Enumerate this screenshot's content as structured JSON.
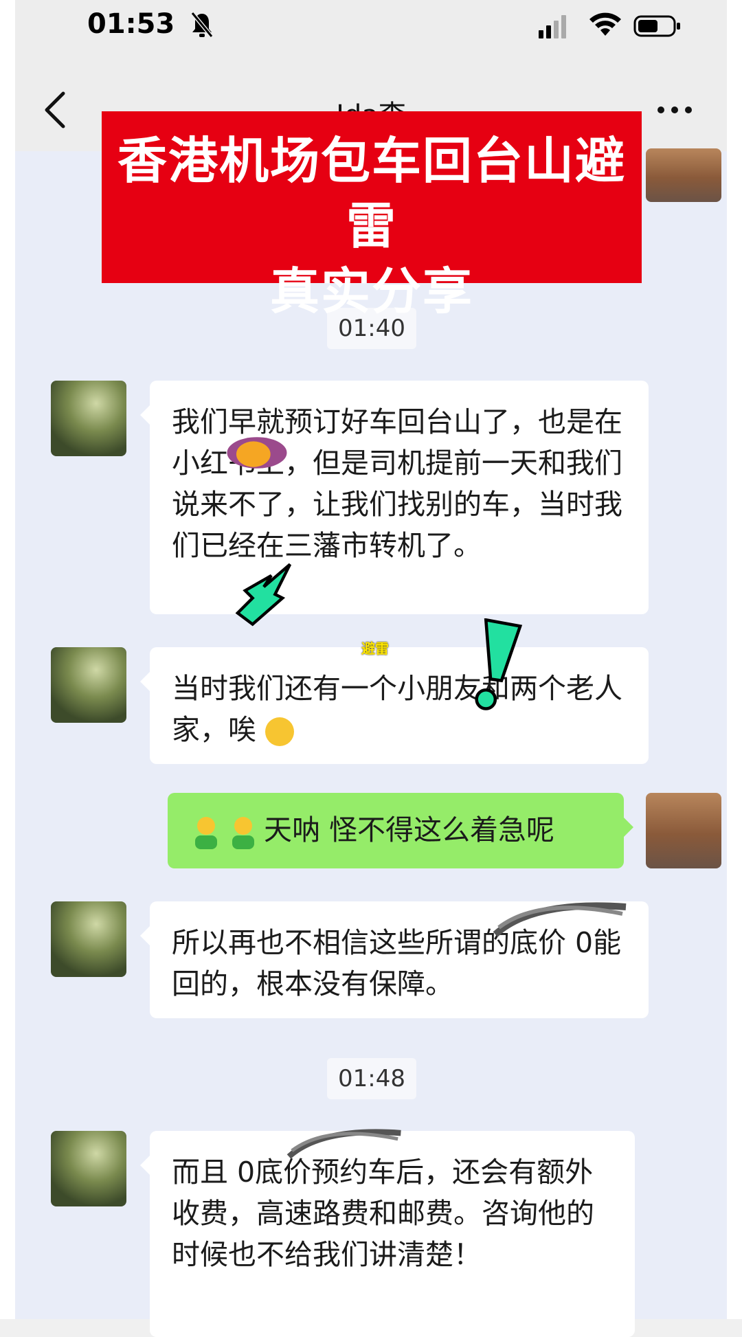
{
  "status_bar": {
    "time": "01:53",
    "icons": [
      "bell-off-icon",
      "signal-icon",
      "wifi-icon",
      "battery-icon"
    ]
  },
  "header": {
    "title": "Ida李",
    "back_icon": "chevron-left-icon",
    "more_icon": "more-icon"
  },
  "banner": {
    "line1": "香港机场包车回台山避雷",
    "line2": "真实分享"
  },
  "sticker_label": "避雷",
  "messages": [
    {
      "type": "time",
      "text": "01:40"
    },
    {
      "type": "peer",
      "text": "我们早就预订好车回台山了，也是在小红书上，但是司机提前一天和我们说来不了，让我们找别的车，当时我们已经在三藩市转机了。"
    },
    {
      "type": "peer",
      "text": "当时我们还有一个小朋友和两个老人家，唉"
    },
    {
      "type": "me",
      "text": "天呐 怪不得这么着急呢"
    },
    {
      "type": "peer",
      "text": "所以再也不相信这些所谓的底价 0能回的，根本没有保障。"
    },
    {
      "type": "time",
      "text": "01:48"
    },
    {
      "type": "peer",
      "text": "而且 0底价预约车后，还会有额外收费，高速路费和邮费。咨询他的时候也不给我们讲清楚！"
    }
  ],
  "colors": {
    "banner": "#e60012",
    "my_bubble": "#95ec69",
    "peer_bubble": "#ffffff",
    "chat_bg": "#e9edf8",
    "sticker_green": "#22e0a0"
  }
}
